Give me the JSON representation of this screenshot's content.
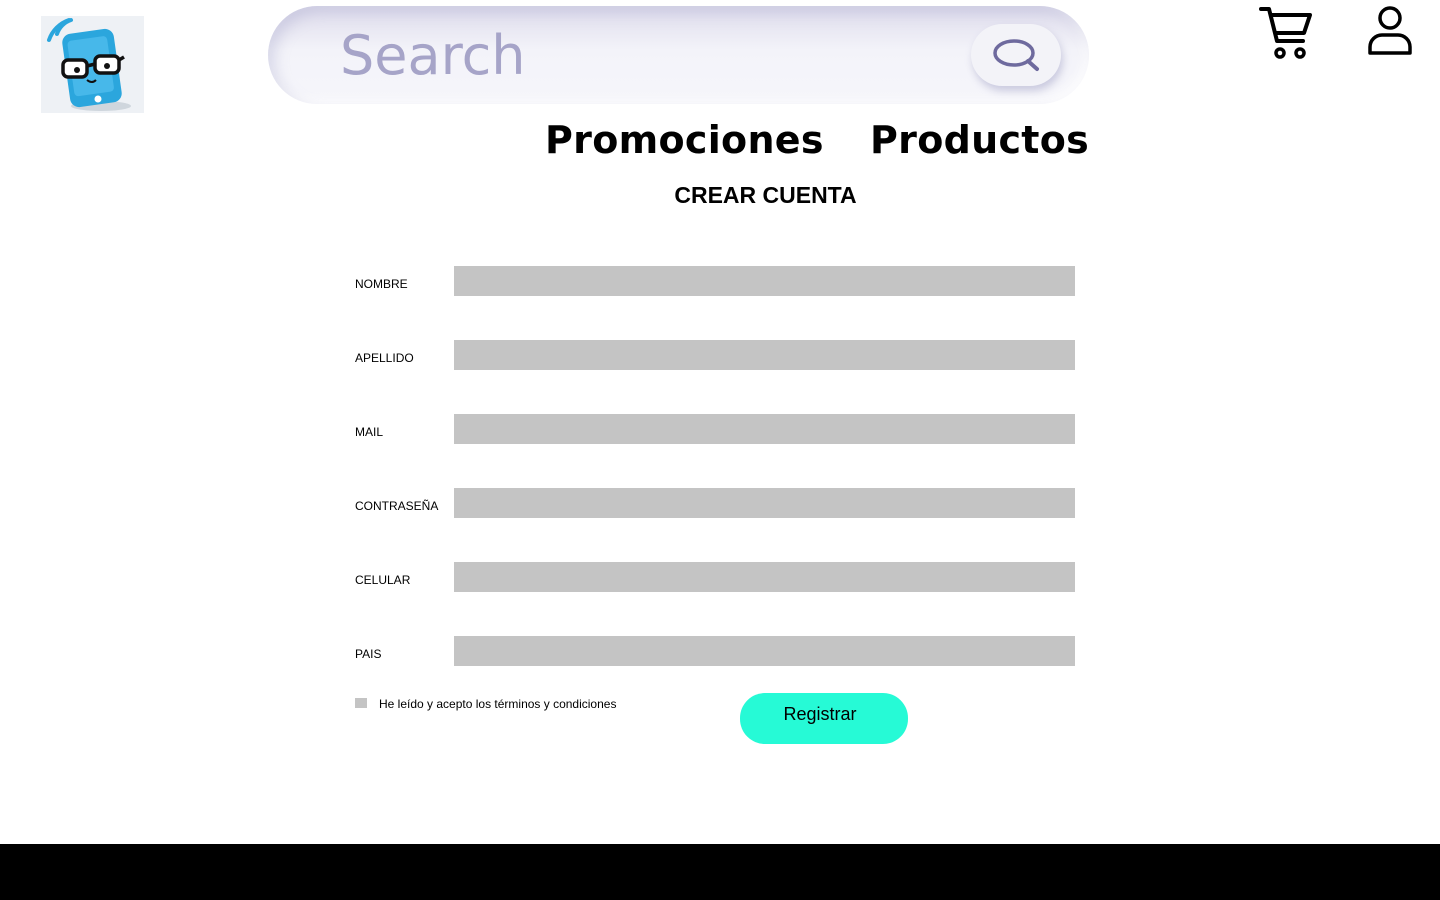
{
  "header": {
    "search": {
      "placeholder": "Search"
    },
    "nav": [
      {
        "label": "Promociones"
      },
      {
        "label": "Productos"
      }
    ]
  },
  "page": {
    "title": "CREAR CUENTA"
  },
  "form": {
    "fields": [
      {
        "label": "NOMBRE",
        "value": ""
      },
      {
        "label": "APELLIDO",
        "value": ""
      },
      {
        "label": "MAIL",
        "value": ""
      },
      {
        "label": "CONTRASEÑA",
        "value": ""
      },
      {
        "label": "CELULAR",
        "value": ""
      },
      {
        "label": "PAIS",
        "value": ""
      }
    ],
    "terms_label": "He leído y acepto los términos y condiciones",
    "terms_checked": false,
    "submit_label": "Registrar"
  },
  "icons": {
    "logo": "phone-nerd-logo",
    "search": "search-icon",
    "cart": "cart-icon",
    "user": "user-icon"
  },
  "colors": {
    "accent": "#26fad6",
    "input_bg": "#c4c4c4",
    "footer": "#000000",
    "search_text": "#a6a4c8"
  }
}
